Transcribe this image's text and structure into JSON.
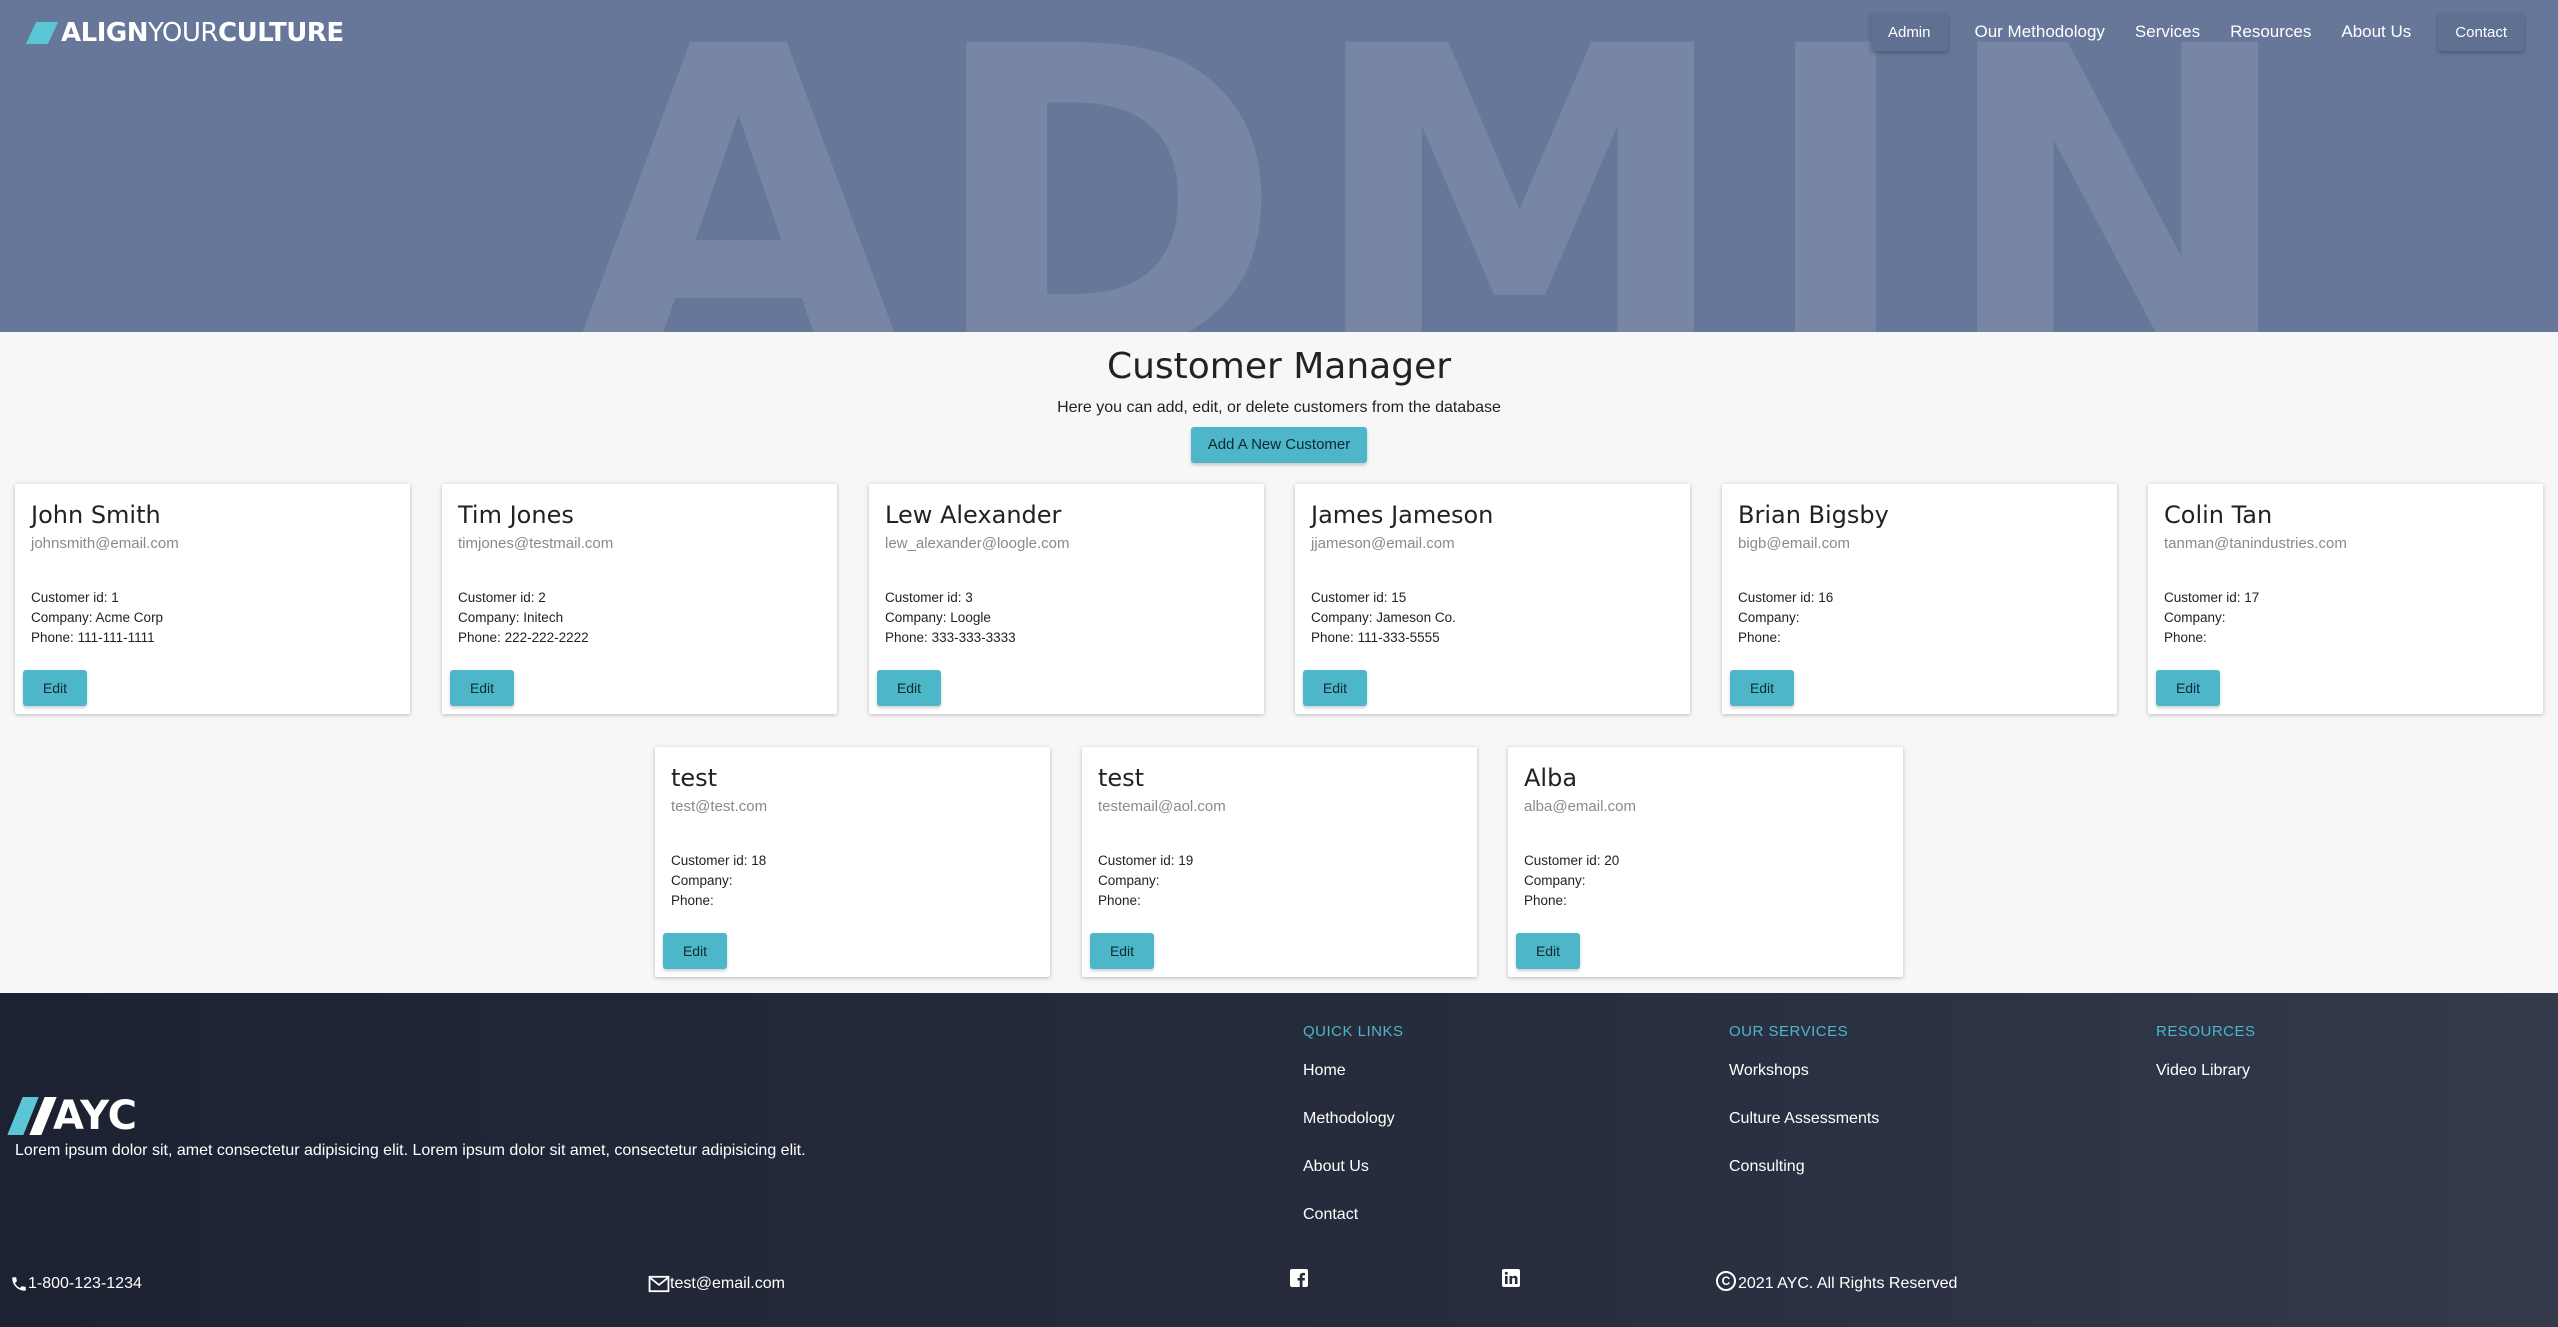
{
  "brand": {
    "logo_bold1": "ALIGN",
    "logo_light": "YOUR",
    "logo_bold2": "CULTURE",
    "hero_bg_text": "ADMIN"
  },
  "nav": [
    {
      "label": "Admin"
    },
    {
      "label": "Our Methodology"
    },
    {
      "label": "Services"
    },
    {
      "label": "Resources"
    },
    {
      "label": "About Us"
    },
    {
      "label": "Contact"
    }
  ],
  "main": {
    "title": "Customer Manager",
    "subtitle": "Here you can add, edit, or delete customers from the database",
    "add_button": "Add A New Customer"
  },
  "labels": {
    "id": "Customer id:",
    "company": "Company:",
    "phone": "Phone:",
    "edit": "Edit"
  },
  "customers": [
    {
      "name": "John Smith",
      "email": "johnsmith@email.com",
      "id": "1",
      "company": "Acme Corp",
      "phone": "111-111-1111"
    },
    {
      "name": "Tim Jones",
      "email": "timjones@testmail.com",
      "id": "2",
      "company": "Initech",
      "phone": "222-222-2222"
    },
    {
      "name": "Lew Alexander",
      "email": "lew_alexander@loogle.com",
      "id": "3",
      "company": "Loogle",
      "phone": "333-333-3333"
    },
    {
      "name": "James Jameson",
      "email": "jjameson@email.com",
      "id": "15",
      "company": "Jameson Co.",
      "phone": "111-333-5555"
    },
    {
      "name": "Brian Bigsby",
      "email": "bigb@email.com",
      "id": "16",
      "company": "",
      "phone": ""
    },
    {
      "name": "Colin Tan",
      "email": "tanman@tanindustries.com",
      "id": "17",
      "company": "",
      "phone": ""
    },
    {
      "name": "test",
      "email": "test@test.com",
      "id": "18",
      "company": "",
      "phone": ""
    },
    {
      "name": "test",
      "email": "testemail@aol.com",
      "id": "19",
      "company": "",
      "phone": ""
    },
    {
      "name": "Alba",
      "email": "alba@email.com",
      "id": "20",
      "company": "",
      "phone": ""
    }
  ],
  "footer": {
    "logo": "AYC",
    "tagline": "Lorem ipsum dolor sit, amet consectetur adipisicing elit. Lorem ipsum dolor sit amet, consectetur adipisicing elit.",
    "quick_links": {
      "heading": "QUICK LINKS",
      "items": [
        "Home",
        "Methodology",
        "About Us",
        "Contact"
      ]
    },
    "services": {
      "heading": "OUR SERVICES",
      "items": [
        "Workshops",
        "Culture Assessments",
        "Consulting"
      ]
    },
    "resources": {
      "heading": "RESOURCES",
      "items": [
        "Video Library"
      ]
    },
    "phone": "1-800-123-1234",
    "email": "test@email.com",
    "copyright": "2021 AYC. All Rights Reserved",
    "accent": "#4db6c9"
  }
}
